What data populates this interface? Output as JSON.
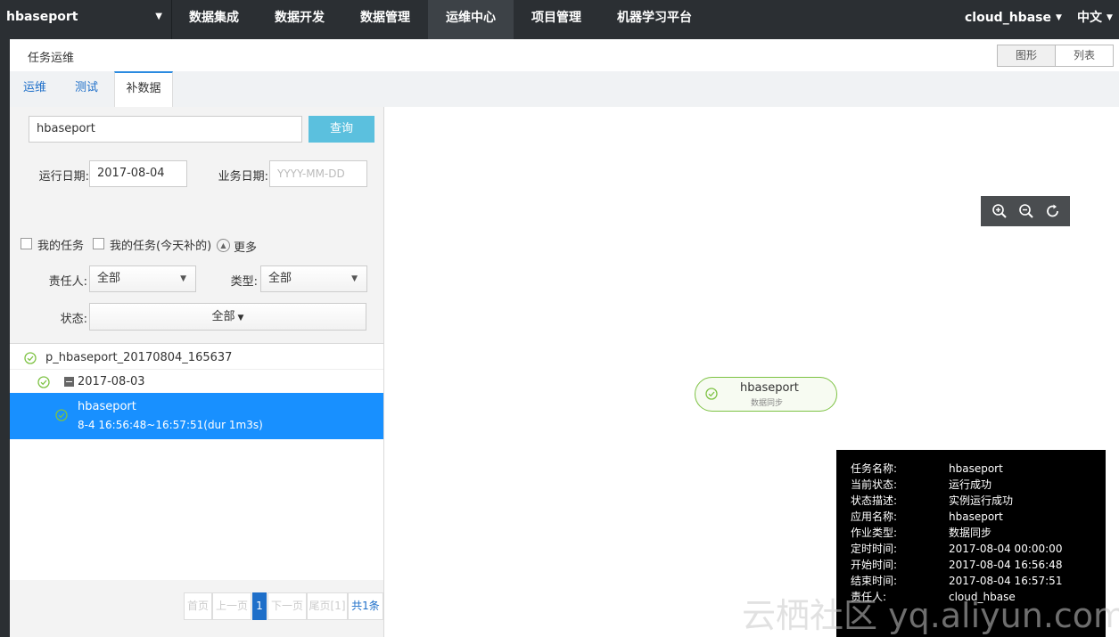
{
  "topbar": {
    "project": "hbaseport",
    "nav": [
      "数据集成",
      "数据开发",
      "数据管理",
      "运维中心",
      "项目管理",
      "机器学习平台"
    ],
    "active_nav": "运维中心",
    "user": "cloud_hbase",
    "language": "中文"
  },
  "header": {
    "title": "任务运维",
    "view_graph": "图形",
    "view_list": "列表"
  },
  "tabs": [
    "运维",
    "测试",
    "补数据"
  ],
  "active_tab": "补数据",
  "filters": {
    "search_value": "hbaseport",
    "search_button": "查询",
    "run_date_label": "运行日期:",
    "run_date_value": "2017-08-04",
    "biz_date_label": "业务日期:",
    "biz_date_placeholder": "YYYY-MM-DD",
    "my_tasks": "我的任务",
    "my_tasks_today": "我的任务(今天补的)",
    "more": "更多",
    "owner_label": "责任人:",
    "owner_value": "全部",
    "type_label": "类型:",
    "type_value": "全部",
    "status_label": "状态:",
    "status_value": "全部"
  },
  "tree": {
    "root": "p_hbaseport_20170804_165637",
    "date_node": "2017-08-03",
    "task_name": "hbaseport",
    "task_time": "8-4 16:56:48~16:57:51(dur 1m3s)"
  },
  "pager": {
    "first": "首页",
    "prev": "上一页",
    "current": "1",
    "next": "下一页",
    "last": "尾页[1]",
    "total": "共1条"
  },
  "node": {
    "name": "hbaseport",
    "type": "数据同步",
    "status_color": "#7dc243"
  },
  "tooltip": {
    "rows": [
      {
        "k": "任务名称:",
        "v": "hbaseport"
      },
      {
        "k": "当前状态:",
        "v": "运行成功"
      },
      {
        "k": "状态描述:",
        "v": "实例运行成功"
      },
      {
        "k": "应用名称:",
        "v": "hbaseport"
      },
      {
        "k": "作业类型:",
        "v": "数据同步"
      },
      {
        "k": "定时时间:",
        "v": "2017-08-04 00:00:00"
      },
      {
        "k": "开始时间:",
        "v": "2017-08-04 16:56:48"
      },
      {
        "k": "结束时间:",
        "v": "2017-08-04 16:57:51"
      },
      {
        "k": "责任人:",
        "v": "cloud_hbase"
      }
    ]
  },
  "watermark": "云栖社区 yq.aliyun.com",
  "colors": {
    "topbar": "#2b2f33",
    "accent": "#1890ff",
    "search_button": "#5bc0de",
    "success": "#7dc243"
  }
}
